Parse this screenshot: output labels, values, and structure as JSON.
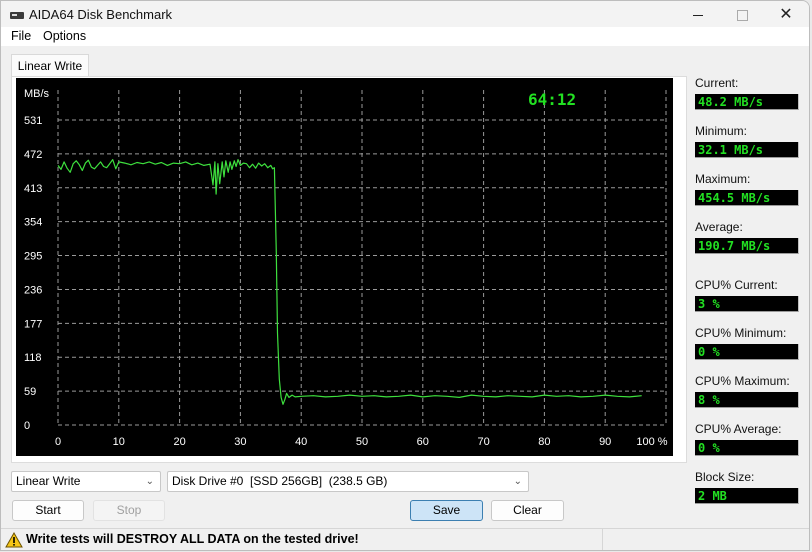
{
  "window": {
    "title": "AIDA64 Disk Benchmark",
    "controls": {
      "minimize": "minimize",
      "maximize": "maximize",
      "close": "close"
    }
  },
  "menu": {
    "items": [
      "File",
      "Options"
    ]
  },
  "tabs": [
    {
      "label": "Linear Write",
      "active": true
    }
  ],
  "chart_overlay": {
    "elapsed_time": "64:12"
  },
  "chart_data": {
    "type": "line",
    "title": "",
    "xlabel": "",
    "ylabel": "MB/s",
    "ylim": [
      0,
      590
    ],
    "xlim": [
      0,
      100
    ],
    "grid": true,
    "y_ticks": [
      0,
      59,
      118,
      177,
      236,
      295,
      354,
      413,
      472,
      531
    ],
    "x_ticks": [
      0,
      10,
      20,
      30,
      40,
      50,
      60,
      70,
      80,
      90,
      100
    ],
    "x_tick_labels": [
      "0",
      "10",
      "20",
      "30",
      "40",
      "50",
      "60",
      "70",
      "80",
      "90",
      "100 %"
    ],
    "line_color": "#3ee03e",
    "series": [
      {
        "name": "Linear Write",
        "x": [
          0,
          0.5,
          1,
          1.5,
          2,
          2.5,
          3,
          3.5,
          4,
          4.5,
          5,
          5.5,
          6,
          6.5,
          7,
          7.5,
          8,
          8.5,
          9,
          9.5,
          10,
          11,
          12,
          13,
          14,
          15,
          16,
          17,
          18,
          19,
          20,
          21,
          22,
          23,
          24,
          25,
          25.5,
          25.8,
          26,
          26.3,
          26.6,
          27,
          27.3,
          27.6,
          28,
          28.3,
          28.6,
          29,
          29.3,
          29.6,
          30,
          30.5,
          31,
          31.5,
          32,
          32.5,
          33,
          33.5,
          34,
          34.5,
          35,
          35.3,
          35.6,
          35.9,
          36.1,
          36.4,
          36.7,
          37,
          37.3,
          37.6,
          38,
          38.5,
          39,
          40,
          42,
          44,
          46,
          48,
          50,
          52,
          54,
          56,
          58,
          60,
          62,
          64,
          66,
          68,
          70,
          72,
          74,
          76,
          78,
          80,
          82,
          84,
          86,
          88,
          90,
          92,
          94,
          96,
          98,
          100
        ],
        "values": [
          452,
          445,
          458,
          447,
          440,
          455,
          460,
          453,
          443,
          456,
          461,
          449,
          446,
          452,
          458,
          450,
          448,
          455,
          462,
          446,
          458,
          456,
          453,
          457,
          455,
          458,
          454,
          457,
          452,
          456,
          455,
          458,
          453,
          456,
          452,
          454,
          418,
          458,
          402,
          455,
          420,
          458,
          432,
          460,
          440,
          458,
          445,
          460,
          450,
          462,
          452,
          456,
          455,
          448,
          454,
          447,
          456,
          451,
          455,
          448,
          452,
          446,
          448,
          300,
          160,
          80,
          48,
          36,
          44,
          55,
          48,
          52,
          49,
          50,
          51,
          49,
          50,
          52,
          50,
          51,
          49,
          50,
          52,
          49,
          51,
          50,
          48,
          52,
          50,
          49,
          51,
          50,
          49,
          52,
          50,
          51,
          49,
          50,
          52,
          50,
          49,
          51
        ]
      }
    ]
  },
  "stats": [
    {
      "label": "Current:",
      "value": "48.2 MB/s"
    },
    {
      "label": "Minimum:",
      "value": "32.1 MB/s"
    },
    {
      "label": "Maximum:",
      "value": "454.5 MB/s"
    },
    {
      "label": "Average:",
      "value": "190.7 MB/s"
    },
    {
      "label": "CPU% Current:",
      "value": "3 %"
    },
    {
      "label": "CPU% Minimum:",
      "value": "0 %"
    },
    {
      "label": "CPU% Maximum:",
      "value": "8 %"
    },
    {
      "label": "CPU% Average:",
      "value": "0 %"
    },
    {
      "label": "Block Size:",
      "value": "2 MB"
    }
  ],
  "controls": {
    "test_select": "Linear Write",
    "drive_select": "Disk Drive #0  [SSD 256GB]  (238.5 GB)",
    "start": "Start",
    "stop": "Stop",
    "save": "Save",
    "clear": "Clear"
  },
  "status": {
    "warning": "Write tests will DESTROY ALL DATA on the tested drive!"
  },
  "colors": {
    "chart_bg": "#000000",
    "line": "#3ee03e",
    "stat_text": "#22e022",
    "grid": "#9a9a9a",
    "time": "#22e022"
  }
}
